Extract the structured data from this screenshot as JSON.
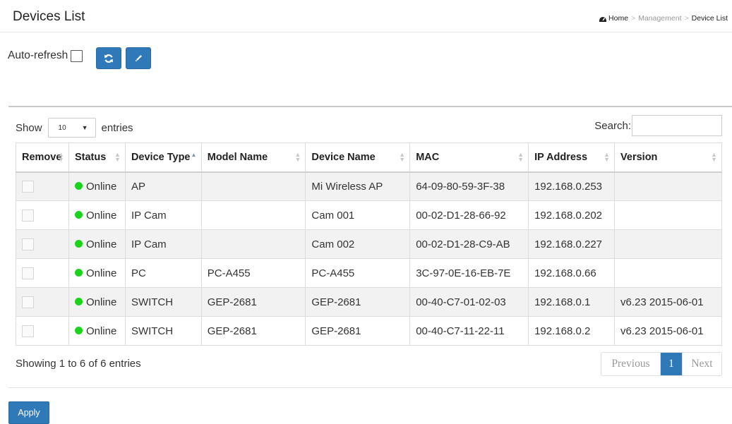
{
  "header": {
    "title": "Devices List",
    "breadcrumb": {
      "home": "Home",
      "section": "Management",
      "current": "Device List"
    }
  },
  "toolbar": {
    "auto_refresh_label": "Auto-refresh",
    "auto_refresh_checked": false,
    "refresh_icon": "refresh-icon",
    "edit_icon": "pencil-icon"
  },
  "table_controls": {
    "show_label": "Show",
    "entries_value": "10",
    "entries_label": "entries",
    "search_label": "Search:",
    "search_value": ""
  },
  "table": {
    "columns": [
      "Remove",
      "Status",
      "Device Type",
      "Model Name",
      "Device Name",
      "MAC",
      "IP Address",
      "Version"
    ],
    "sorted_column": "Device Type",
    "sort_direction": "ascending",
    "rows": [
      {
        "status": "Online",
        "device_type": "AP",
        "model_name": "",
        "device_name": "Mi Wireless AP",
        "mac": "64-09-80-59-3F-38",
        "ip": "192.168.0.253",
        "version": ""
      },
      {
        "status": "Online",
        "device_type": "IP Cam",
        "model_name": "",
        "device_name": "Cam 001",
        "mac": "00-02-D1-28-66-92",
        "ip": "192.168.0.202",
        "version": ""
      },
      {
        "status": "Online",
        "device_type": "IP Cam",
        "model_name": "",
        "device_name": "Cam 002",
        "mac": "00-02-D1-28-C9-AB",
        "ip": "192.168.0.227",
        "version": ""
      },
      {
        "status": "Online",
        "device_type": "PC",
        "model_name": "PC-A455",
        "device_name": "PC-A455",
        "mac": "3C-97-0E-16-EB-7E",
        "ip": "192.168.0.66",
        "version": ""
      },
      {
        "status": "Online",
        "device_type": "SWITCH",
        "model_name": "GEP-2681",
        "device_name": "GEP-2681",
        "mac": "00-40-C7-01-02-03",
        "ip": "192.168.0.1",
        "version": "v6.23 2015-06-01"
      },
      {
        "status": "Online",
        "device_type": "SWITCH",
        "model_name": "GEP-2681",
        "device_name": "GEP-2681",
        "mac": "00-40-C7-11-22-11",
        "ip": "192.168.0.2",
        "version": "v6.23 2015-06-01"
      }
    ]
  },
  "footer": {
    "info": "Showing 1 to 6 of 6 entries",
    "pagination": {
      "previous": "Previous",
      "current_page": "1",
      "next": "Next"
    },
    "apply_label": "Apply"
  },
  "colors": {
    "primary": "#2f79b9",
    "online": "#1bd31b",
    "row_stripe": "#f2f2f2"
  }
}
